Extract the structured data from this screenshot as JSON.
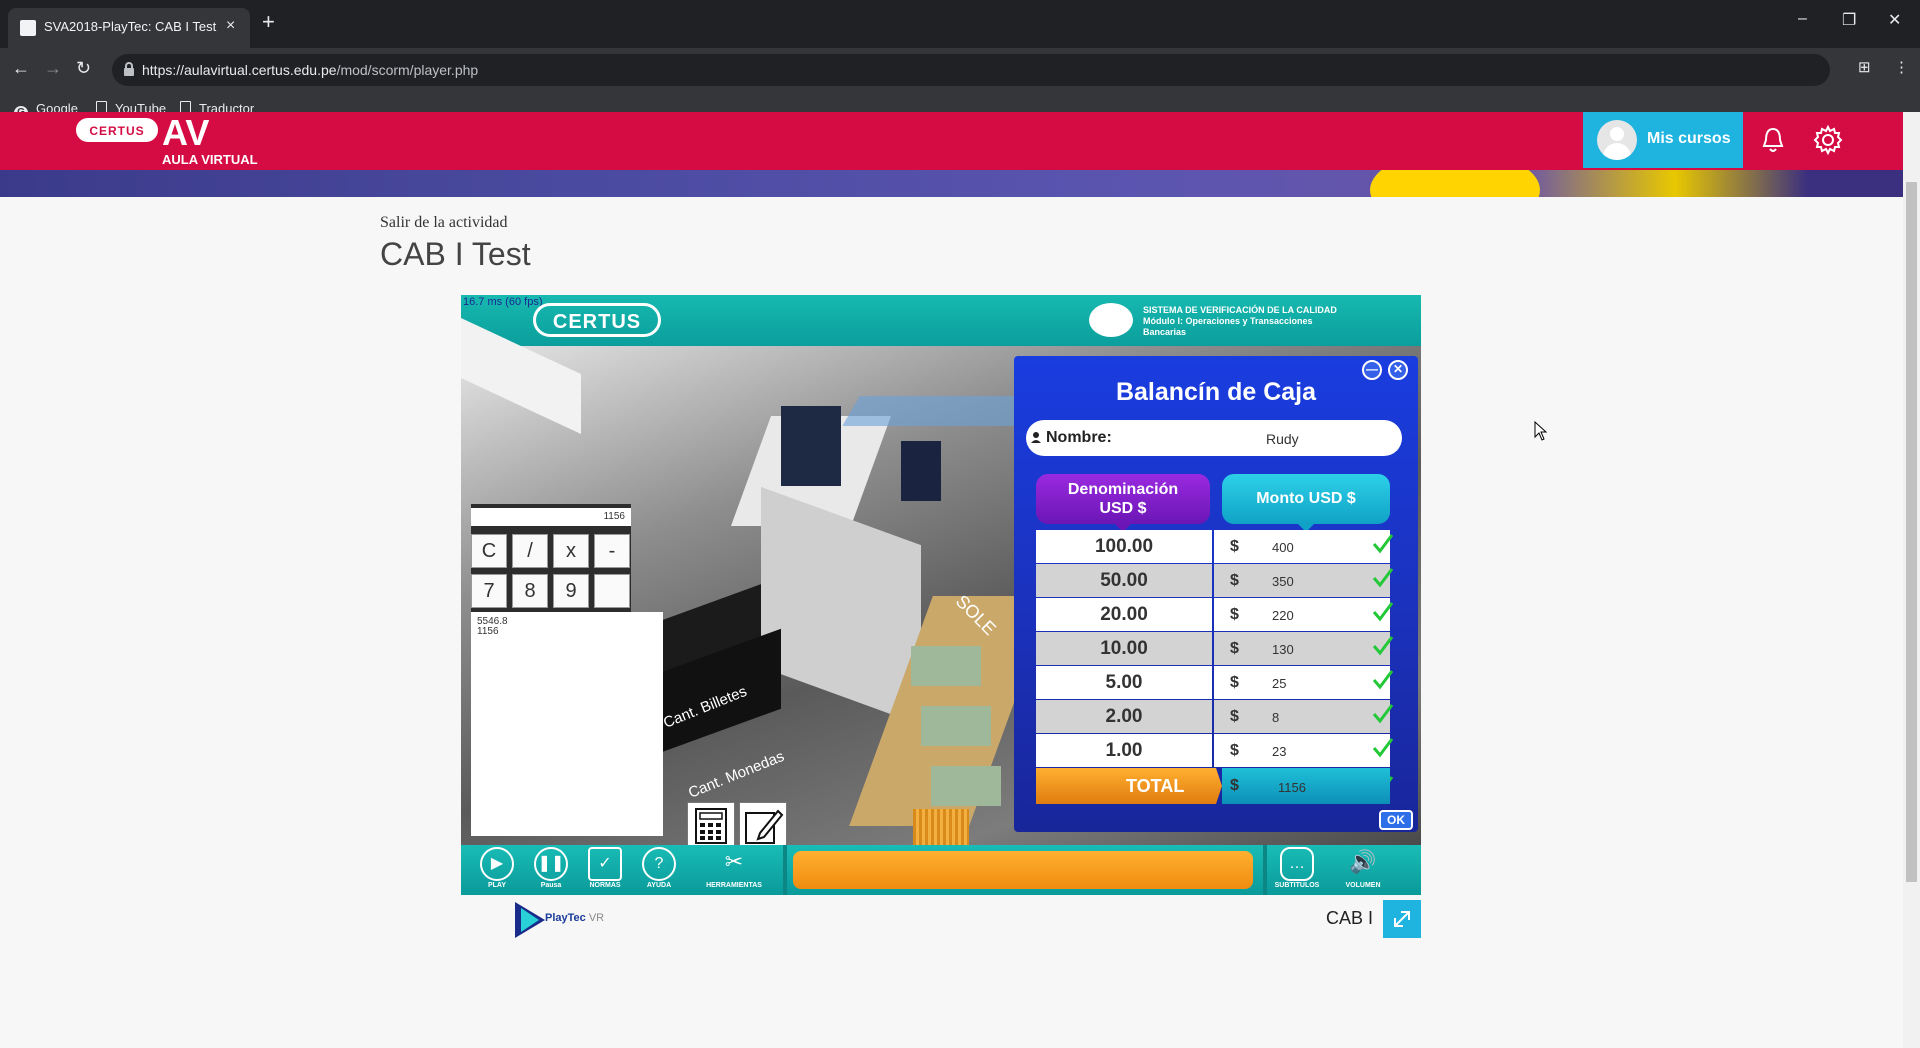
{
  "browser": {
    "tab_title": "SVA2018-PlayTec: CAB I Test",
    "tab_close": "×",
    "new_tab": "+",
    "url_host": "https://aulavirtual.certus.edu.pe",
    "url_path": "/mod/scorm/player.php",
    "window_controls": {
      "minimize": "–",
      "restore": "❐",
      "close": "✕"
    },
    "nav": {
      "back": "←",
      "forward": "→",
      "reload": "↻",
      "bookmark_star": "☆"
    },
    "bookmarks": [
      "Google",
      "YouTube",
      "Traductor"
    ]
  },
  "site": {
    "logo_pill": "CERTUS",
    "logo_av": "AV",
    "logo_sub": "AULA VIRTUAL",
    "my_courses": "Mis cursos",
    "brand_color": "#d50c44",
    "accent_color": "#1fb3e0"
  },
  "page": {
    "exit_link": "Salir de la actividad",
    "title": "CAB I Test",
    "bottom_label": "CAB I"
  },
  "game": {
    "fps": "16.7 ms (60 fps)",
    "certus_logo": "CERTUS",
    "system_line1": "SISTEMA DE VERIFICACIÓN DE LA CALIDAD",
    "system_line2": "Módulo I: Operaciones y Transacciones",
    "system_line3": "Bancarias",
    "calculator": {
      "display": "1156",
      "keys_row1": [
        "C",
        "/",
        "x",
        "-"
      ],
      "keys_row2": [
        "7",
        "8",
        "9",
        ""
      ],
      "tape_line1": "5546.8",
      "tape_line2": "1156"
    },
    "scene_labels": {
      "billetes": "Cant. Billetes",
      "monedas": "Cant. Monedas",
      "soles": "SOLE"
    },
    "balance": {
      "title": "Balancín de Caja",
      "name_label": "Nombre:",
      "name_value": "Rudy",
      "col_denom_line1": "Denominación",
      "col_denom_line2": "USD $",
      "col_amount": "Monto USD $",
      "currency_symbol": "$",
      "rows": [
        {
          "denom": "100.00",
          "amount": "400"
        },
        {
          "denom": "50.00",
          "amount": "350"
        },
        {
          "denom": "20.00",
          "amount": "220"
        },
        {
          "denom": "10.00",
          "amount": "130"
        },
        {
          "denom": "5.00",
          "amount": "25"
        },
        {
          "denom": "2.00",
          "amount": "8"
        },
        {
          "denom": "1.00",
          "amount": "23"
        }
      ],
      "total_label": "TOTAL",
      "total_value": "1156",
      "ok": "OK",
      "minimize": "—",
      "close": "✕"
    },
    "toolbar": {
      "play": "PLAY",
      "pause": "Pausa",
      "normas": "NORMAS",
      "ayuda": "AYUDA",
      "herramientas": "HERRAMIENTAS",
      "subtitulos": "SUBTITULOS",
      "volumen": "VOLUMEN"
    },
    "playtec_brand": "PlayTec",
    "playtec_suffix": "VR"
  }
}
